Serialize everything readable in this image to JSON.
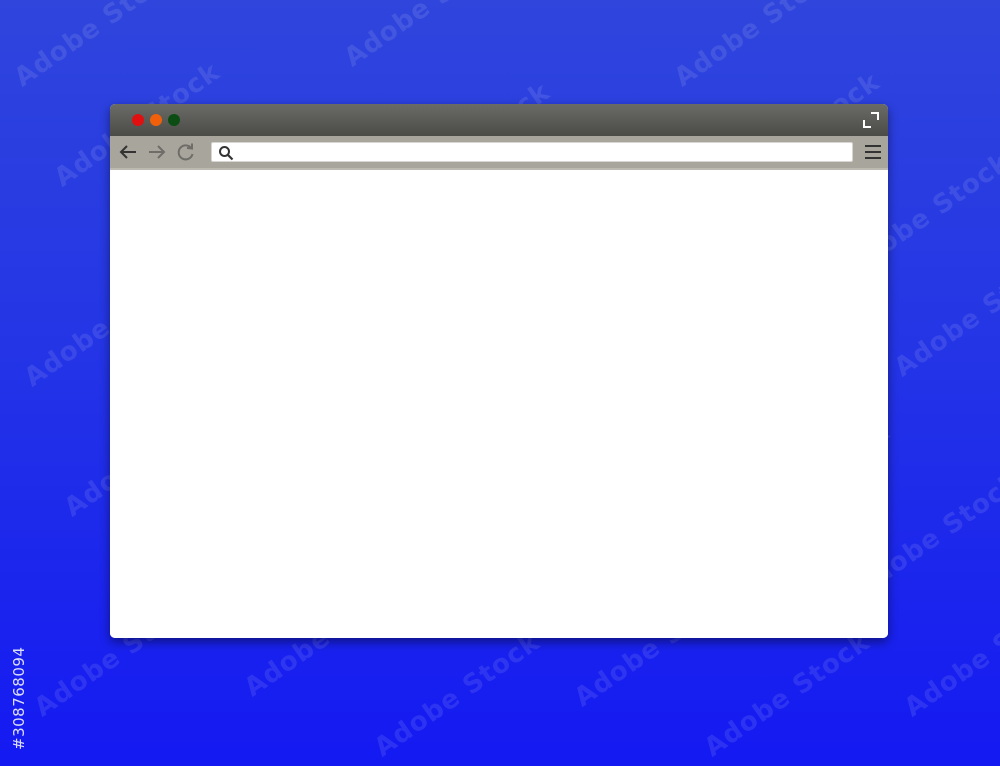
{
  "watermark": {
    "text": "Adobe Stock"
  },
  "side_id": {
    "text": "#308768094"
  },
  "browser": {
    "window_controls": [
      {
        "name": "close",
        "color": "#e01010"
      },
      {
        "name": "minimize",
        "color": "#f0600a"
      },
      {
        "name": "maximize",
        "color": "#0b4d12"
      }
    ],
    "toolbar": {
      "back_icon": "arrow-left-icon",
      "forward_icon": "arrow-right-icon",
      "reload_icon": "reload-icon",
      "menu_icon": "hamburger-menu-icon"
    },
    "address_bar": {
      "value": "",
      "search_icon": "search-icon"
    },
    "colors": {
      "titlebar": "#565653",
      "toolbar": "#a8a59c",
      "background_top": "#2f45dc",
      "background_bottom": "#1419f2"
    }
  }
}
